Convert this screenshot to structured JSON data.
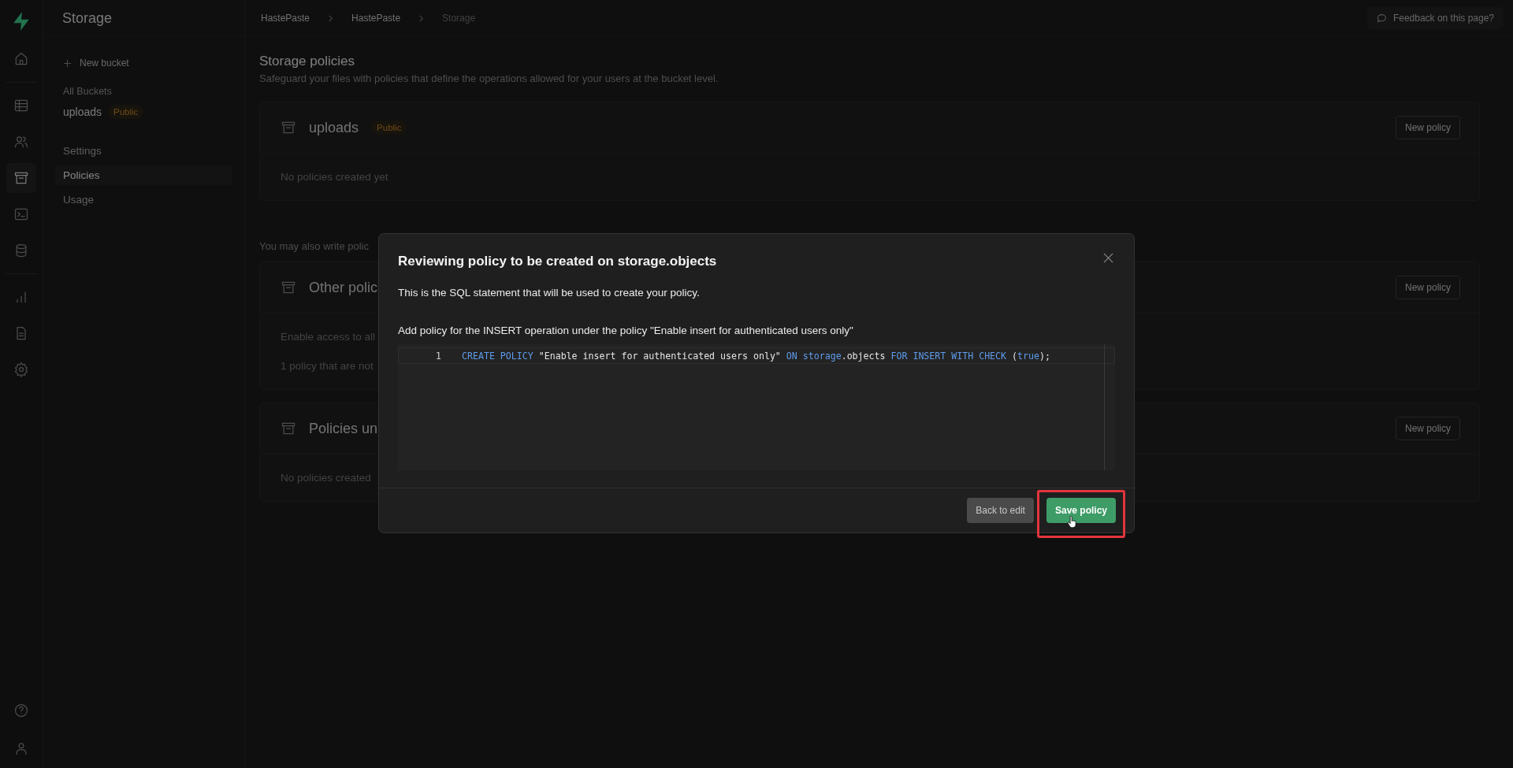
{
  "rail": {
    "top": [
      {
        "kind": "home",
        "selected": false
      },
      {
        "kind": "divider"
      },
      {
        "kind": "table",
        "selected": false
      },
      {
        "kind": "users",
        "selected": false
      },
      {
        "kind": "archive",
        "selected": true
      },
      {
        "kind": "terminal",
        "selected": false
      },
      {
        "kind": "database",
        "selected": false
      },
      {
        "kind": "divider"
      },
      {
        "kind": "chart",
        "selected": false
      },
      {
        "kind": "document",
        "selected": false
      },
      {
        "kind": "settings",
        "selected": false
      }
    ],
    "bottom": [
      {
        "kind": "help",
        "selected": false
      },
      {
        "kind": "user",
        "selected": false
      }
    ]
  },
  "sidebar": {
    "title": "Storage",
    "new_bucket": "New bucket",
    "buckets_heading": "All Buckets",
    "buckets": [
      {
        "name": "uploads",
        "badge": "Public"
      }
    ],
    "items": [
      {
        "label": "Settings",
        "selected": false
      },
      {
        "label": "Policies",
        "selected": true
      },
      {
        "label": "Usage",
        "selected": false
      }
    ]
  },
  "breadcrumbs": [
    {
      "label": "HastePaste",
      "current": false
    },
    {
      "label": "HastePaste",
      "current": false
    },
    {
      "label": "Storage",
      "current": true
    }
  ],
  "feedback_button": "Feedback on this page?",
  "page": {
    "title": "Storage policies",
    "subtitle": "Safeguard your files with policies that define the operations allowed for your users at the bucket level.",
    "bucket_card": {
      "name": "uploads",
      "badge": "Public",
      "button": "New policy",
      "empty": "No policies created yet"
    },
    "note": "You may also write polic",
    "cards": [
      {
        "title": "Other polic",
        "button": "New policy",
        "rows": [
          "Enable access to all",
          "1 policy that are not"
        ]
      },
      {
        "title": "Policies un",
        "button": "New policy",
        "rows": [
          "No policies created"
        ]
      }
    ]
  },
  "modal": {
    "title": "Reviewing policy to be created on storage.objects",
    "description": "This is the SQL statement that will be used to create your policy.",
    "summary": "Add policy for the INSERT operation under the policy \"Enable insert for authenticated users only\"",
    "code_lines": [
      {
        "number": "1",
        "tokens": [
          {
            "kind": "keyword",
            "text": "CREATE POLICY"
          },
          {
            "kind": "plain",
            "text": " \"Enable insert for authenticated users only\" "
          },
          {
            "kind": "keyword",
            "text": "ON storage"
          },
          {
            "kind": "plain",
            "text": ".objects "
          },
          {
            "kind": "keyword",
            "text": "FOR INSERT WITH CHECK"
          },
          {
            "kind": "plain",
            "text": " ("
          },
          {
            "kind": "keyword",
            "text": "true"
          },
          {
            "kind": "plain",
            "text": ");"
          }
        ]
      }
    ],
    "buttons": [
      {
        "label": "Back to edit",
        "kind": "secondary",
        "highlighted": false
      },
      {
        "label": "Save policy",
        "kind": "primary",
        "highlighted": true
      }
    ]
  }
}
